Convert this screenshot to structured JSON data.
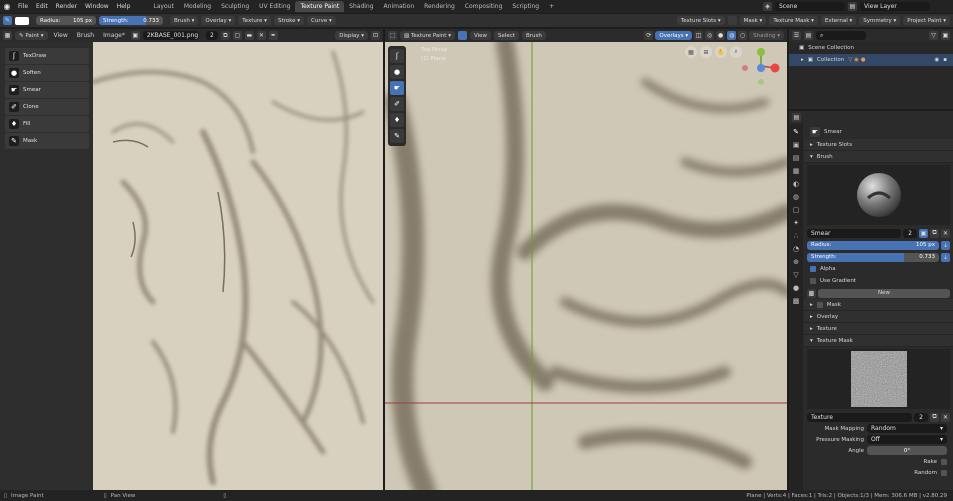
{
  "menubar": {
    "items": [
      "File",
      "Edit",
      "Render",
      "Window",
      "Help"
    ]
  },
  "workspaces": {
    "tabs": [
      "Layout",
      "Modeling",
      "Sculpting",
      "UV Editing",
      "Texture Paint",
      "Shading",
      "Animation",
      "Rendering",
      "Compositing",
      "Scripting"
    ],
    "active": "Texture Paint",
    "add": "+"
  },
  "scene": {
    "name": "Scene",
    "view_layer": "View Layer"
  },
  "tool_header": {
    "radius_label": "Radius:",
    "radius_value": "105 px",
    "strength_label": "Strength:",
    "strength_value": "0.733",
    "menus": [
      "Brush",
      "Overlay",
      "Texture",
      "Stroke",
      "Curve"
    ],
    "right": [
      "Texture Slots",
      "Mask",
      "Texture Mask",
      "External",
      "Symmetry",
      "Project Paint"
    ]
  },
  "image_editor": {
    "mode": "Paint",
    "menus": [
      "View",
      "Brush",
      "Image*"
    ],
    "image_name": "2KBASE_001.png",
    "users": "2",
    "display": "Display",
    "tools": [
      "TexDraw",
      "Soften",
      "Smear",
      "Clone",
      "Fill",
      "Mask"
    ]
  },
  "viewport": {
    "mode": "Texture Paint",
    "menus": [
      "View",
      "Select",
      "Brush"
    ],
    "overlays": "Overlays",
    "shading": "Shading",
    "view_name": "Top Persp",
    "object_name": "(1) Plane"
  },
  "outliner": {
    "root": "Scene Collection",
    "collection": "Collection"
  },
  "properties": {
    "brush_name": "Smear",
    "sections": {
      "texture_slots": "Texture Slots",
      "brush": "Brush",
      "mask": "Mask",
      "overlay": "Overlay",
      "texture": "Texture",
      "texture_mask": "Texture Mask"
    },
    "brush_field": "Smear",
    "brush_users": "2",
    "radius_label": "Radius:",
    "radius_value": "105 px",
    "strength_label": "Strength:",
    "strength_value": "0.733",
    "strength_fraction": 0.733,
    "alpha": "Alpha",
    "use_gradient": "Use Gradient",
    "new_button": "New",
    "texture_field": "Texture",
    "texture_users": "2",
    "mask_mapping_label": "Mask Mapping",
    "mask_mapping_value": "Random",
    "pressure_masking_label": "Pressure Masking",
    "pressure_masking_value": "Off",
    "angle_label": "Angle",
    "angle_value": "0°",
    "rake": "Rake",
    "random": "Random"
  },
  "status": {
    "left": "Image Paint",
    "middle": "Pan View",
    "right": "Plane | Verts:4 | Faces:1 | Tris:2 | Objects:1/3 | Mem: 306.6 MB | v2.80.29"
  },
  "colors": {
    "accent": "#4772b3",
    "active_tab": "#474747",
    "canvas": "#d9d2c2"
  }
}
